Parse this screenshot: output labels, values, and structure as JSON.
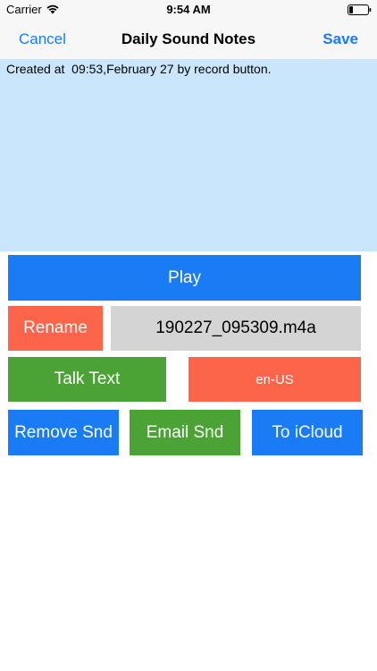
{
  "status_bar": {
    "carrier": "Carrier",
    "time": "9:54 AM"
  },
  "nav": {
    "cancel_label": "Cancel",
    "title": "Daily Sound Notes",
    "save_label": "Save"
  },
  "note": {
    "text": "Created at  09:53,February 27 by record button."
  },
  "controls": {
    "play_label": "Play",
    "rename_label": "Rename",
    "file_name": "190227_095309.m4a",
    "talk_label": "Talk Text",
    "language": "en-US",
    "remove_label": "Remove Snd",
    "email_label": "Email Snd",
    "icloud_label": "To iCloud"
  },
  "colors": {
    "accent_blue": "#1a7cf5",
    "orange": "#fd654a",
    "green": "#4aa334",
    "note_background": "#c9e6fd",
    "field_gray": "#d4d4d4"
  },
  "icons": {
    "wifi": "wifi-icon",
    "battery": "battery-icon"
  }
}
